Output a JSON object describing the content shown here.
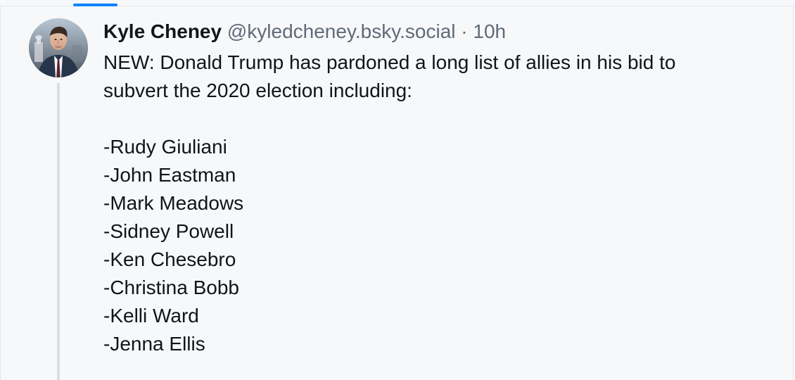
{
  "feed": {
    "post": {
      "author": {
        "name": "Kyle Cheney",
        "handle": "@kyledcheney.bsky.social",
        "avatar_icon": "user-avatar"
      },
      "meta": {
        "separator": "·",
        "time": "10h"
      },
      "content": {
        "lines": [
          "NEW: Donald Trump has pardoned a long list of allies in his bid to",
          "subvert the 2020 election including:"
        ],
        "names": [
          "-Rudy Giuliani",
          "-John Eastman",
          "-Mark Meadows",
          "-Sidney Powell",
          "-Ken Chesebro",
          "-Christina Bobb",
          "-Kelli Ward",
          "-Jenna Ellis"
        ]
      }
    }
  },
  "colors": {
    "background": "#f7f8fa",
    "accent": "#1083fe",
    "text": "#111418",
    "muted": "#5f6b78",
    "thread_line": "#d7dee6"
  }
}
